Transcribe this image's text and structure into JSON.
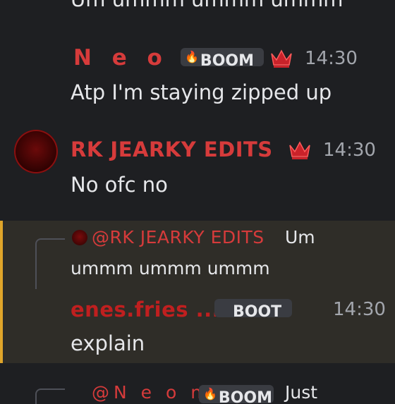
{
  "messages": [
    {
      "text": "Um ummm ummm ummm"
    },
    {
      "username": "N e o n",
      "tag": "BOOM",
      "time": "14:30",
      "text": "Atp I'm staying zipped up"
    },
    {
      "username": "RK JEARKY EDITS",
      "time": "14:30",
      "text": "No ofc no"
    },
    {
      "reply_mention": "@RK JEARKY EDITS",
      "reply_text_1": "Um",
      "reply_text_2": "ummm ummm ummm",
      "username": "enes.fries ...",
      "tag": "BOOT",
      "time": "14:30",
      "text": "explain"
    },
    {
      "reply_mention": "@N e o n",
      "tag": "BOOM",
      "reply_text": "Just"
    }
  ],
  "colors": {
    "background": "#1e1f22",
    "highlight": "#2f2d28",
    "highlight_bar": "#e0a52a",
    "username": "#d63b3b",
    "timestamp": "#a3a6ad"
  },
  "icons": [
    "crown-icon",
    "flame-icon",
    "avatar"
  ]
}
